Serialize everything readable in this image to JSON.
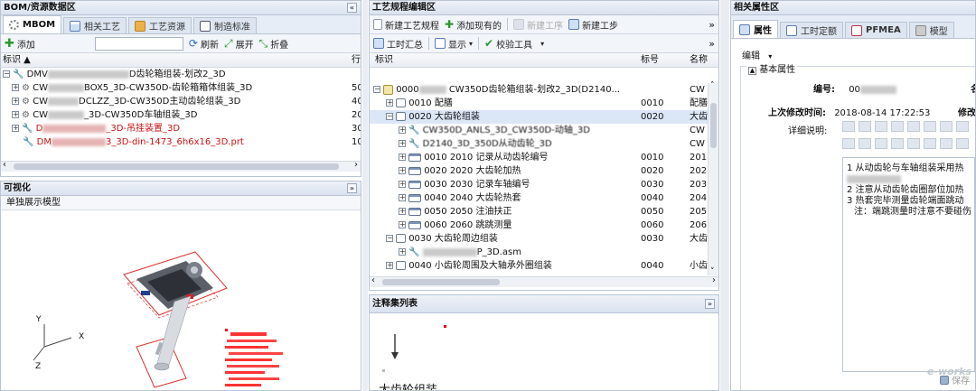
{
  "left_top": {
    "title": "BOM/资源数据区",
    "collapse": "«",
    "tabs": [
      {
        "label": "MBOM",
        "icon": "gear-icon",
        "active": true
      },
      {
        "label": "相关工艺",
        "icon": "table-icon",
        "active": false
      },
      {
        "label": "工艺资源",
        "icon": "folder-icon",
        "active": false
      },
      {
        "label": "制造标准",
        "icon": "hierarchy-icon",
        "active": false
      }
    ],
    "toolbar": {
      "add": "添加",
      "refresh": "刷新",
      "expand": "展开",
      "fold": "折叠"
    },
    "columns": {
      "name": "标识 ▲",
      "rev": "行"
    },
    "rows": [
      {
        "prefix": "DMV",
        "text": "D齿轮箱组装-划改2_3D",
        "rev": "",
        "icon": "wrench-icon",
        "red": false
      },
      {
        "prefix": "CW",
        "text": "BOX5_3D-CW350D-齿轮箱箱体组装_3D",
        "rev": "50",
        "icon": "gear-icon",
        "red": false
      },
      {
        "prefix": "CW",
        "text": "DCLZZ_3D-CW350D主动齿轮组装_3D",
        "rev": "40",
        "icon": "gear-icon",
        "red": false
      },
      {
        "prefix": "CW",
        "text": "_3D-CW350D车轴组装_3D",
        "rev": "20",
        "icon": "gear-icon",
        "red": false
      },
      {
        "prefix": "D",
        "text": "_3D-吊挂装置_3D",
        "rev": "30",
        "icon": "wrench-icon",
        "red": true
      },
      {
        "prefix": "DM",
        "text": "3_3D-din-1473_6h6x16_3D.prt",
        "rev": "10",
        "icon": "wrench-icon",
        "red": true
      }
    ]
  },
  "left_bottom": {
    "title": "可视化",
    "collapse": "»",
    "subtab": "单独展示模型",
    "axes": {
      "x": "X",
      "y": "Y",
      "z": "Z"
    }
  },
  "middle_top": {
    "title": "工艺规程编辑区",
    "toolbar1": {
      "new_proc": "新建工艺规程",
      "add_existing": "添加现有的",
      "new_op": "新建工序",
      "new_step": "新建工步",
      "more": "»"
    },
    "toolbar2": {
      "summary": "工时汇总",
      "display": "显示",
      "check": "校验工具",
      "more": "»"
    },
    "columns": {
      "name": "标识",
      "num": "标号",
      "title": "名称"
    },
    "rows": [
      {
        "level": 0,
        "text": "0000",
        "blurred": "CW350D齿轮箱组装-划改2_3D(D2140...",
        "num": "",
        "title": "CW",
        "sel": false
      },
      {
        "level": 1,
        "text": "0010 配膳",
        "num": "0010",
        "title": "配膳",
        "sel": false
      },
      {
        "level": 1,
        "text": "0020 大齿轮组装",
        "num": "0020",
        "title": "大齿",
        "sel": true
      },
      {
        "level": 2,
        "text": "CW350D_ANLS_3D_CW350D-动轴_3D",
        "num": "",
        "title": "CW",
        "sel": false
      },
      {
        "level": 2,
        "text": "D2140_3D_350D从动齿轮_3D",
        "num": "",
        "title": "CW",
        "sel": false
      },
      {
        "level": 2,
        "text": "0010 2010 记录从动齿轮编号",
        "num": "0010",
        "title": "201",
        "sel": false
      },
      {
        "level": 2,
        "text": "0020 2020 大齿轮加热",
        "num": "0020",
        "title": "202",
        "sel": false
      },
      {
        "level": 2,
        "text": "0030 2030 记录车轴编号",
        "num": "0030",
        "title": "203",
        "sel": false
      },
      {
        "level": 2,
        "text": "0040 2040 大齿轮热套",
        "num": "0040",
        "title": "204",
        "sel": false
      },
      {
        "level": 2,
        "text": "0050 2050 注油扶正",
        "num": "0050",
        "title": "205",
        "sel": false
      },
      {
        "level": 2,
        "text": "0060 2060 跳跳测量",
        "num": "0060",
        "title": "206",
        "sel": false
      },
      {
        "level": 1,
        "text": "0030 大齿轮周边组装",
        "num": "0030",
        "title": "大齿",
        "sel": false
      },
      {
        "level": 2,
        "text": "P_3D.asm",
        "num": "",
        "title": "",
        "sel": false
      },
      {
        "level": 1,
        "text": "0040 小齿轮周围及大轴承外圈组装",
        "num": "0040",
        "title": "小齿",
        "sel": false
      }
    ]
  },
  "middle_bottom": {
    "title": "注释集列表",
    "collapse": "»",
    "note": "大齿轮组装"
  },
  "right": {
    "title": "相关属性区",
    "tabs": [
      {
        "label": "属性",
        "active": true
      },
      {
        "label": "工时定额",
        "active": false
      },
      {
        "label": "PFMEA",
        "active": false
      },
      {
        "label": "模型",
        "active": false
      }
    ],
    "edit": "编辑",
    "group": "基本属性",
    "fields": {
      "code_label": "编号:",
      "code_value": "00",
      "name_label": "名",
      "modtime_label": "上次修改时间:",
      "modtime_value": "2018-08-14 17:22:53",
      "modby_label": "修改",
      "desc_label": "详细说明:"
    },
    "desc_lines": [
      "1 从动齿轮与车轴组装采用热",
      "2 注意从动齿轮齿圈部位加热",
      "3 热套完毕测量齿轮端面跳动",
      "注：端跳测量时注意不要碰伤"
    ],
    "save": "保存",
    "watermark": "e-works"
  }
}
